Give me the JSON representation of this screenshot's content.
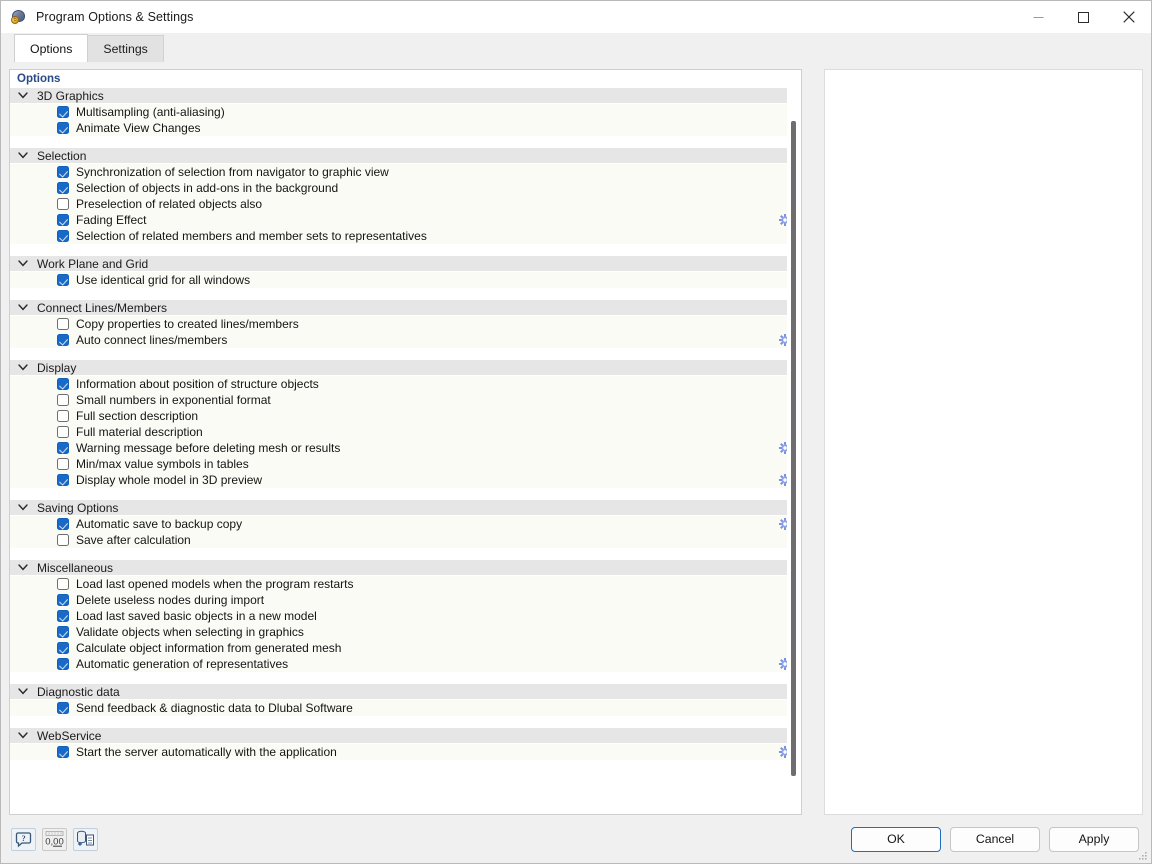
{
  "window": {
    "title": "Program Options & Settings",
    "icon": "app-globe-icon",
    "controls": {
      "minimize": "minimize-icon",
      "maximize": "maximize-icon",
      "close": "close-icon"
    }
  },
  "tabs": [
    {
      "label": "Options",
      "active": true
    },
    {
      "label": "Settings",
      "active": false
    }
  ],
  "left_pane": {
    "title": "Options"
  },
  "sections": [
    {
      "name": "3D Graphics",
      "items": [
        {
          "label": "Multisampling (anti-aliasing)",
          "checked": true,
          "gear": false
        },
        {
          "label": "Animate View Changes",
          "checked": true,
          "gear": false
        }
      ]
    },
    {
      "name": "Selection",
      "items": [
        {
          "label": "Synchronization of selection from navigator to graphic view",
          "checked": true,
          "gear": false
        },
        {
          "label": "Selection of objects in add-ons in the background",
          "checked": true,
          "gear": false
        },
        {
          "label": "Preselection of related objects also",
          "checked": false,
          "gear": false
        },
        {
          "label": "Fading Effect",
          "checked": true,
          "gear": true
        },
        {
          "label": "Selection of related members and member sets to representatives",
          "checked": true,
          "gear": false
        }
      ]
    },
    {
      "name": "Work Plane and Grid",
      "items": [
        {
          "label": "Use identical grid for all windows",
          "checked": true,
          "gear": false
        }
      ]
    },
    {
      "name": "Connect Lines/Members",
      "items": [
        {
          "label": "Copy properties to created lines/members",
          "checked": false,
          "gear": false
        },
        {
          "label": "Auto connect lines/members",
          "checked": true,
          "gear": true
        }
      ]
    },
    {
      "name": "Display",
      "items": [
        {
          "label": "Information about position of structure objects",
          "checked": true,
          "gear": false
        },
        {
          "label": "Small numbers in exponential format",
          "checked": false,
          "gear": false
        },
        {
          "label": "Full section description",
          "checked": false,
          "gear": false
        },
        {
          "label": "Full material description",
          "checked": false,
          "gear": false
        },
        {
          "label": "Warning message before deleting mesh or results",
          "checked": true,
          "gear": true
        },
        {
          "label": "Min/max value symbols in tables",
          "checked": false,
          "gear": false
        },
        {
          "label": "Display whole model in 3D preview",
          "checked": true,
          "gear": true
        }
      ]
    },
    {
      "name": "Saving Options",
      "items": [
        {
          "label": "Automatic save to backup copy",
          "checked": true,
          "gear": true
        },
        {
          "label": "Save after calculation",
          "checked": false,
          "gear": false
        }
      ]
    },
    {
      "name": "Miscellaneous",
      "items": [
        {
          "label": "Load last opened models when the program restarts",
          "checked": false,
          "gear": false
        },
        {
          "label": "Delete useless nodes during import",
          "checked": true,
          "gear": false
        },
        {
          "label": "Load last saved basic objects in a new model",
          "checked": true,
          "gear": false
        },
        {
          "label": "Validate objects when selecting in graphics",
          "checked": true,
          "gear": false
        },
        {
          "label": "Calculate object information from generated mesh",
          "checked": true,
          "gear": false
        },
        {
          "label": "Automatic generation of representatives",
          "checked": true,
          "gear": true
        }
      ]
    },
    {
      "name": "Diagnostic data",
      "items": [
        {
          "label": "Send feedback & diagnostic data to Dlubal Software",
          "checked": true,
          "gear": false
        }
      ]
    },
    {
      "name": "WebService",
      "items": [
        {
          "label": "Start the server automatically with the application",
          "checked": true,
          "gear": true
        }
      ]
    }
  ],
  "annotation": {
    "type": "left-arrow",
    "color": "#3b56e8",
    "points_to": "Start the server automatically with the application"
  },
  "footer": {
    "tools": [
      {
        "name": "help-icon",
        "label": ""
      },
      {
        "name": "decimal-places-icon",
        "label": "0,00"
      },
      {
        "name": "import-export-icon",
        "label": ""
      }
    ],
    "buttons": [
      {
        "label": "OK",
        "default": true
      },
      {
        "label": "Cancel",
        "default": false
      },
      {
        "label": "Apply",
        "default": false
      }
    ]
  },
  "colors": {
    "accent": "#1869c8",
    "annotation": "#3b56e8",
    "pane_title": "#2a4a86",
    "section_header_bg": "#e6e6e6",
    "row_bg": "#fbfbf5"
  }
}
